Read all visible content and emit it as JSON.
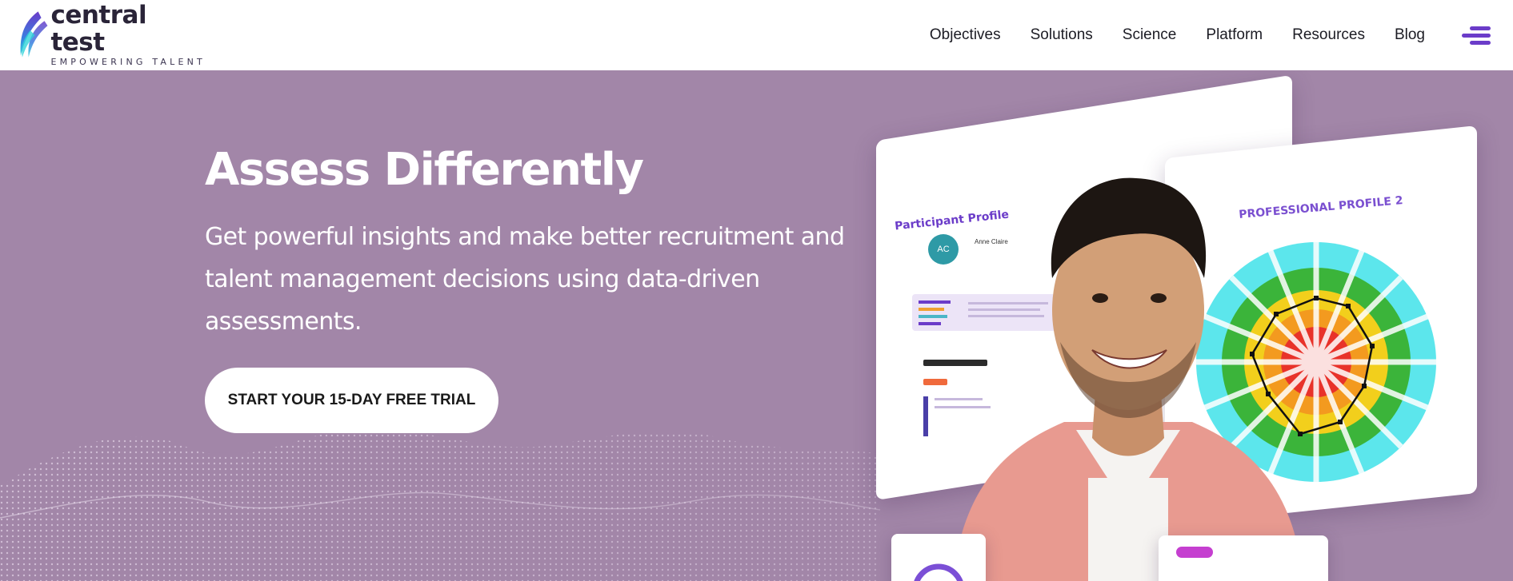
{
  "header": {
    "logo_name": "central test",
    "logo_tagline": "EMPOWERING TALENT",
    "nav": [
      {
        "label": "Objectives"
      },
      {
        "label": "Solutions"
      },
      {
        "label": "Science"
      },
      {
        "label": "Platform"
      },
      {
        "label": "Resources"
      },
      {
        "label": "Blog"
      }
    ],
    "menu_icon": "hamburger-menu-icon"
  },
  "hero": {
    "title": "Assess Differently",
    "subtitle": "Get powerful insights and make better recruitment and talent management decisions using data-driven assessments.",
    "cta_label": "START YOUR 15-DAY FREE TRIAL",
    "illustration": {
      "participant_card_title": "Participant Profile",
      "participant_initials": "AC",
      "participant_name": "Anne Claire",
      "profile_card_title": "PROFESSIONAL PROFILE 2"
    }
  },
  "colors": {
    "hero_background": "#a286a8",
    "accent": "#6b3cc9",
    "cta_background": "#ffffff"
  }
}
